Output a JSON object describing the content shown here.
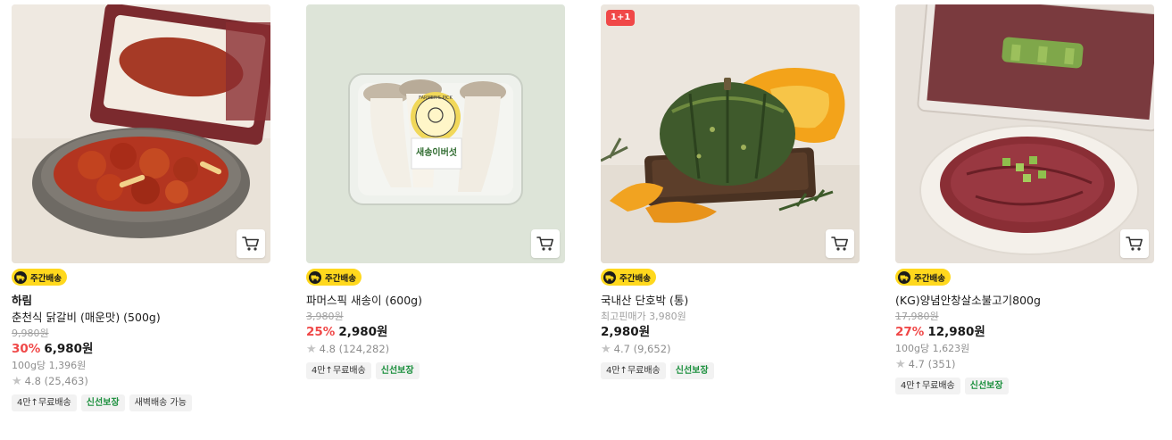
{
  "products": [
    {
      "delivery_badge": "주간배송",
      "brand": "하림",
      "name": "춘천식 닭갈비 (매운맛) (500g)",
      "original_price": "9,980원",
      "discount": "30%",
      "price": "6,980원",
      "unit_price": "100g당 1,396원",
      "rating": "4.8 (25,463)",
      "tags": [
        "4만↑무료배송",
        "신선보장",
        "새벽배송 가능"
      ]
    },
    {
      "delivery_badge": "주간배송",
      "name": "파머스픽 새송이 (600g)",
      "original_price": "3,980원",
      "discount": "25%",
      "price": "2,980원",
      "rating": "4.8 (124,282)",
      "tags": [
        "4만↑무료배송",
        "신선보장"
      ],
      "package_label": "새송이버섯",
      "package_brand": "FARMER'S PICK"
    },
    {
      "promo_badge": "1+1",
      "delivery_badge": "주간배송",
      "name": "국내산 단호박 (통)",
      "lowest_price_note": "최고핀매가 3,980원",
      "price": "2,980원",
      "rating": "4.7 (9,652)",
      "tags": [
        "4만↑무료배송",
        "신선보장"
      ]
    },
    {
      "delivery_badge": "주간배송",
      "name": "(KG)양념안창살소불고기800g",
      "original_price": "17,980원",
      "discount": "27%",
      "price": "12,980원",
      "unit_price": "100g당 1,623원",
      "rating": "4.7 (351)",
      "tags": [
        "4만↑무료배송",
        "신선보장"
      ]
    }
  ],
  "icons": {
    "cart": "cart-icon",
    "star": "star-icon",
    "delivery": "truck-icon"
  },
  "colors": {
    "discount": "#f04848",
    "delivery_badge": "#ffd81d",
    "fresh_tag": "#1a8f3c",
    "promo_badge": "#f04848"
  }
}
